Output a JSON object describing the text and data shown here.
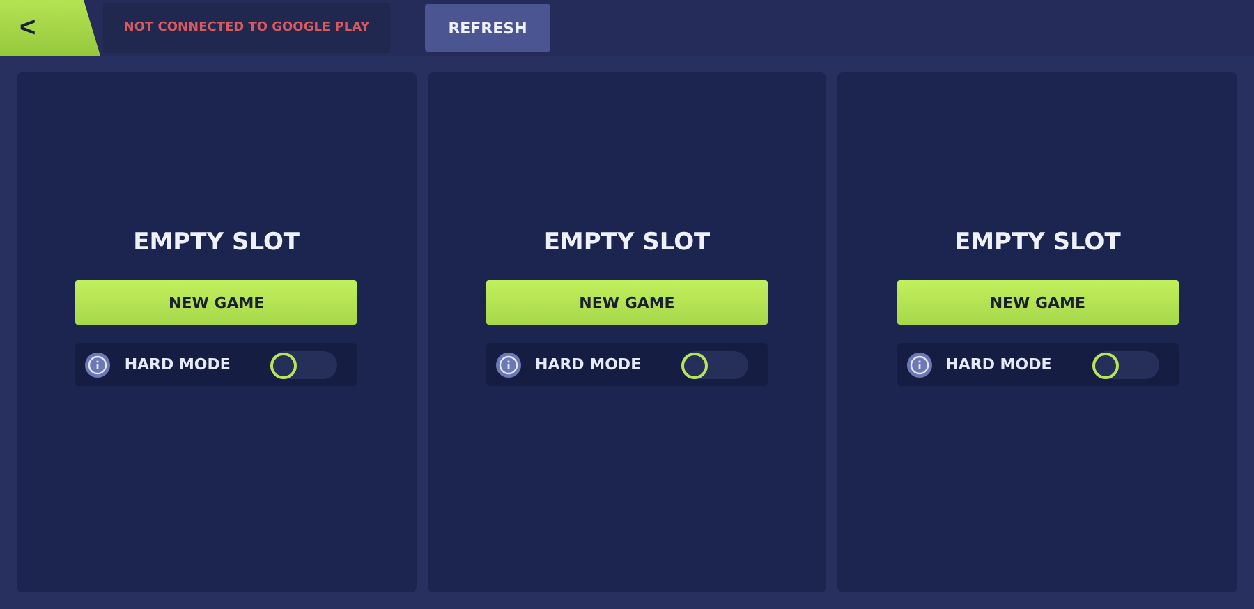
{
  "top_bar": {
    "back": "<",
    "status": "NOT CONNECTED TO GOOGLE PLAY",
    "refresh": "REFRESH"
  },
  "slots": [
    {
      "title": "EMPTY SLOT",
      "button": "NEW GAME",
      "option": {
        "label": "HARD MODE",
        "on": false
      }
    },
    {
      "title": "EMPTY SLOT",
      "button": "NEW GAME",
      "option": {
        "label": "HARD MODE",
        "on": false
      }
    },
    {
      "title": "EMPTY SLOT",
      "button": "NEW GAME",
      "option": {
        "label": "HARD MODE",
        "on": false
      }
    }
  ]
}
